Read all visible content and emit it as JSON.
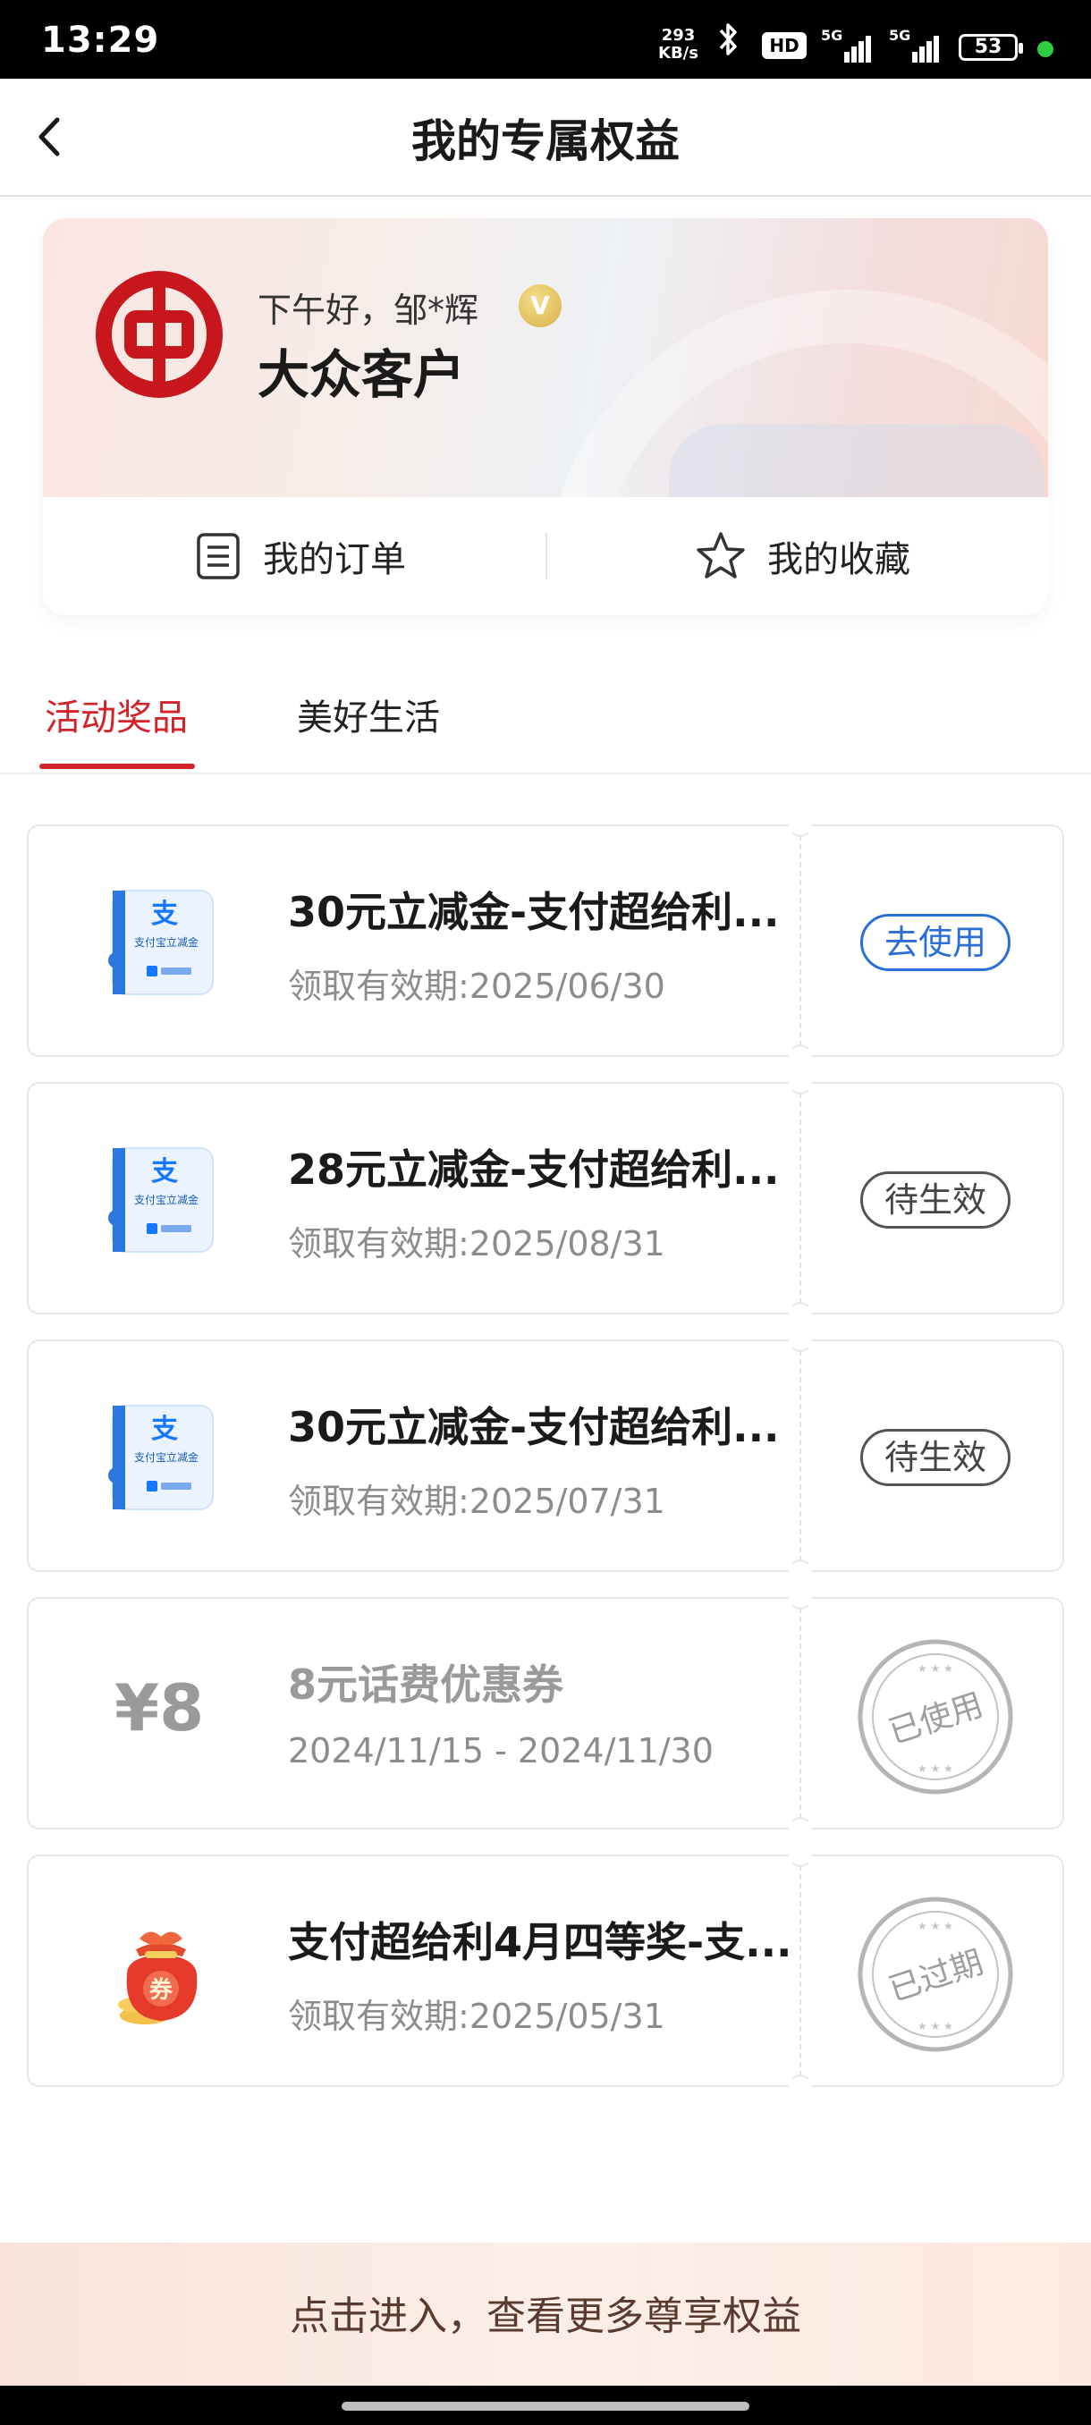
{
  "status_bar": {
    "time": "13:29",
    "net_speed_top": "293",
    "net_speed_bottom": "KB/s",
    "hd": "HD",
    "signal1": "5G",
    "signal2": "5G",
    "battery": "53"
  },
  "header": {
    "title": "我的专属权益"
  },
  "user_card": {
    "greeting": "下午好，邹*辉",
    "badge": "V",
    "level": "大众客户",
    "orders_label": "我的订单",
    "favorites_label": "我的收藏"
  },
  "tabs": [
    {
      "label": "活动奖品",
      "active": true
    },
    {
      "label": "美好生活",
      "active": false
    }
  ],
  "coupons": [
    {
      "title": "30元立减金-支付超给利...",
      "date": "领取有效期:2025/06/30",
      "action": "去使用",
      "icon": "alipay-voucher-icon",
      "icon_text": "支付宝立减金"
    },
    {
      "title": "28元立减金-支付超给利...",
      "date": "领取有效期:2025/08/31",
      "action": "待生效",
      "icon": "alipay-voucher-icon",
      "icon_text": "支付宝立减金"
    },
    {
      "title": "30元立减金-支付超给利...",
      "date": "领取有效期:2025/07/31",
      "action": "待生效",
      "icon": "alipay-voucher-icon",
      "icon_text": "支付宝立减金"
    },
    {
      "title": "8元话费优惠券",
      "date": "2024/11/15 - 2024/11/30",
      "price": "¥8",
      "stamp": "已使用"
    },
    {
      "title": "支付超给利4月四等奖-支...",
      "date": "领取有效期:2025/05/31",
      "icon": "red-lucky-bag-icon",
      "icon_text": "券",
      "stamp": "已过期"
    }
  ],
  "footer": {
    "text": "点击进入，查看更多尊享权益"
  },
  "colors": {
    "brand_red": "#d2232a",
    "action_blue": "#2b6fd6",
    "muted_gray": "#8c8c8c"
  }
}
